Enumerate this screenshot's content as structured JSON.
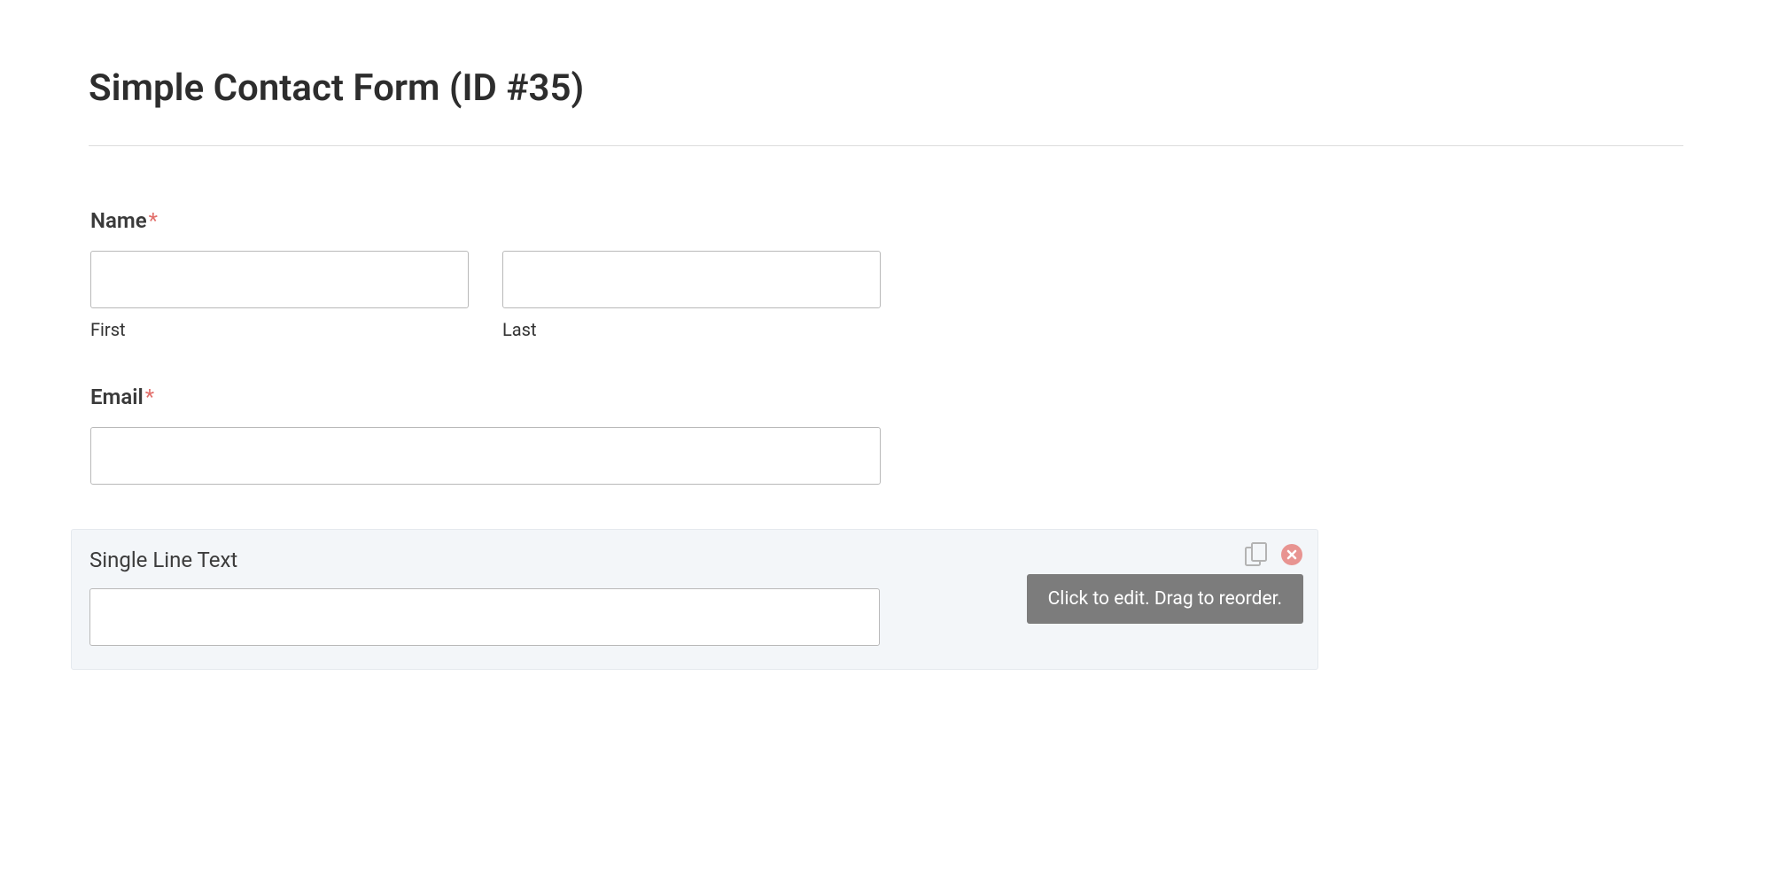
{
  "page": {
    "title": "Simple Contact Form (ID #35)"
  },
  "fields": {
    "name": {
      "label": "Name",
      "required": "*",
      "first_value": "",
      "first_sublabel": "First",
      "last_value": "",
      "last_sublabel": "Last"
    },
    "email": {
      "label": "Email",
      "required": "*",
      "value": ""
    },
    "single_text": {
      "label": "Single Line Text",
      "value": ""
    }
  },
  "tooltip": {
    "text": "Click to edit. Drag to reorder."
  }
}
